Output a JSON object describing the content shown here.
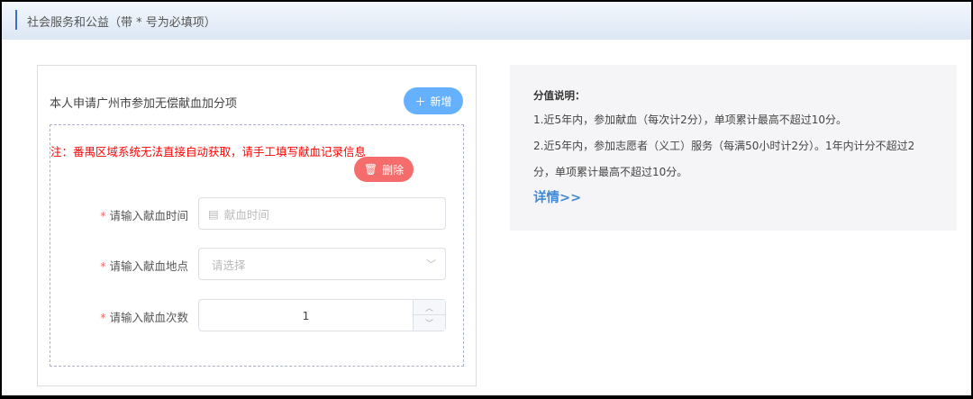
{
  "header": {
    "title": "社会服务和公益（带 * 号为必填项）"
  },
  "card": {
    "title": "本人申请广州市参加无偿献血加分项",
    "add_label": "新增",
    "note": "注：番禺区域系统无法直接自动获取，请手工填写献血记录信息",
    "delete_label": "删除",
    "required_mark": "*",
    "fields": [
      {
        "label": "请输入献血时间",
        "placeholder": "献血时间"
      },
      {
        "label": "请输入献血地点",
        "placeholder": "请选择"
      },
      {
        "label": "请输入献血次数",
        "value": "1"
      }
    ]
  },
  "info": {
    "title": "分值说明：",
    "line1": "1.近5年内，参加献血（每次计2分），单项累计最高不超过10分。",
    "line2": "2.近5年内，参加志愿者（义工）服务（每满50小时计2分）。1年内计分不超过2分，单项累计最高不超过10分。",
    "link": "详情>>"
  },
  "colors": {
    "primary": "#66b1ff",
    "danger": "#f56c6c",
    "note": "#ff0000",
    "link": "#3d8ad8"
  }
}
